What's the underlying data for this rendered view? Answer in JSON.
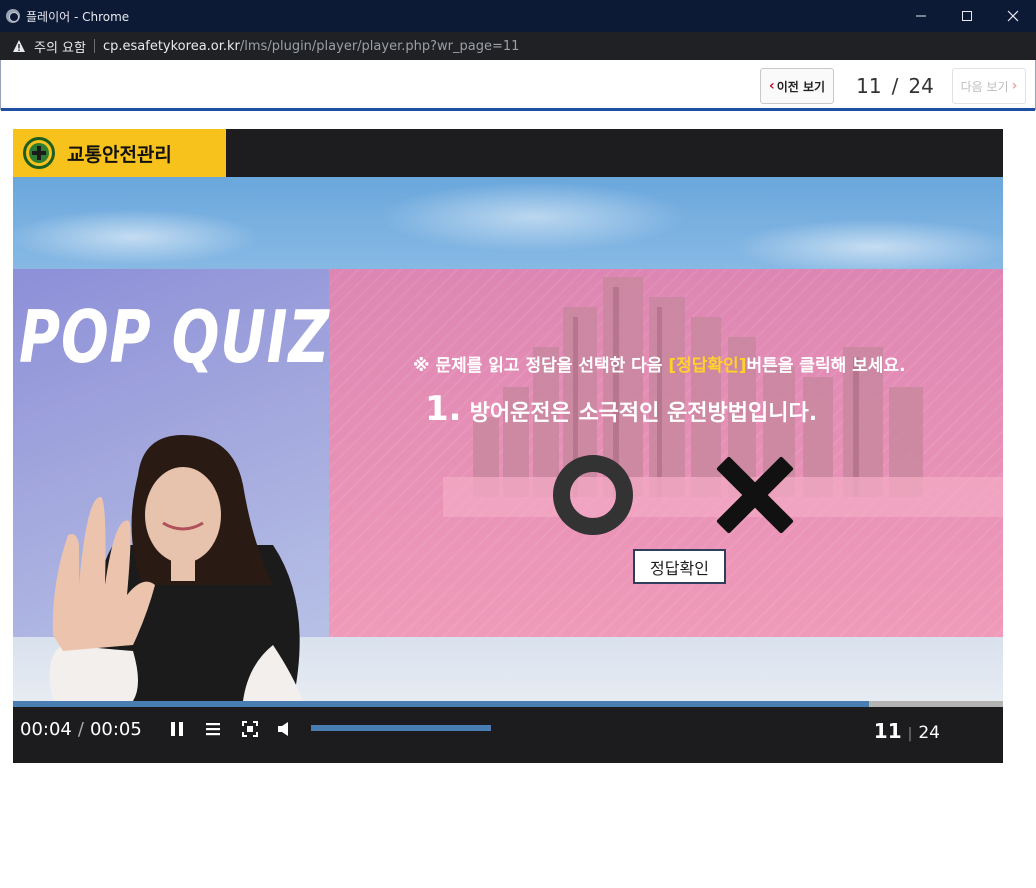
{
  "window": {
    "title": "플레이어 - Chrome"
  },
  "addressbar": {
    "warning": "주의 요함",
    "url_host": "cp.esafetykorea.or.kr",
    "url_path": "/lms/plugin/player/player.php?wr_page=11"
  },
  "nav": {
    "prev_label": "이전 보기",
    "next_label": "다음 보기",
    "current_page": "11",
    "separator": "/",
    "total_pages": "24"
  },
  "course": {
    "title": "교통안전관리"
  },
  "quiz": {
    "banner": "POP QUIZ",
    "instruction_pre": "※ 문제를 읽고 정답을 선택한 다음 ",
    "instruction_highlight": "[정답확인]",
    "instruction_post": "버튼을 클릭해 보세요.",
    "question_number": "1.",
    "question_text": "방어운전은 소극적인 운전방법입니다.",
    "check_button": "정답확인"
  },
  "player": {
    "current_time": "00:04",
    "time_separator": "/",
    "duration": "00:05",
    "progress_fraction": 0.865,
    "volume_fraction": 1.0,
    "slide_current": "11",
    "slide_separator": "|",
    "slide_total": "24",
    "icons": [
      "pause-icon",
      "menu-icon",
      "fullscreen-icon",
      "volume-icon"
    ]
  },
  "colors": {
    "accent_blue": "#1f4fa3",
    "tab_yellow": "#f6c21b",
    "quiz_pink": "#e892b5",
    "progress": "#4a7eb3"
  }
}
